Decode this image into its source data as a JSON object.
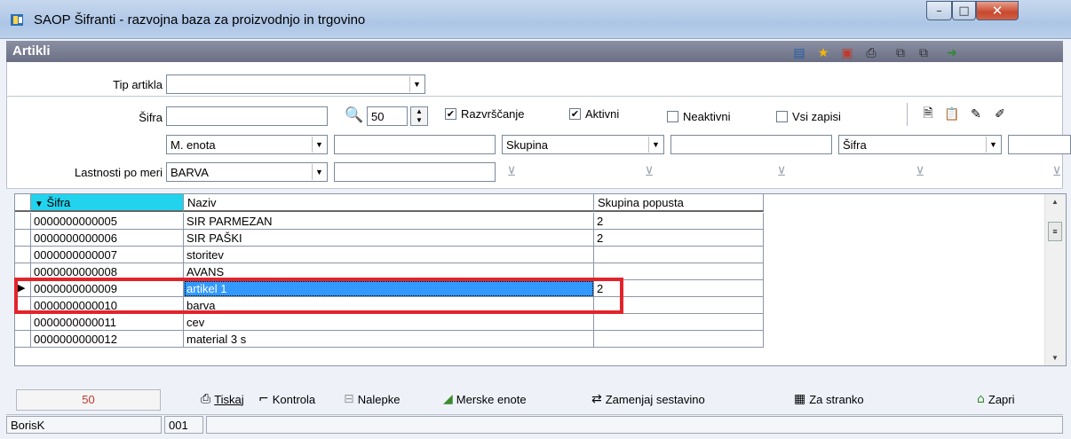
{
  "window": {
    "title": "SAOP Šifranti - razvojna baza za proizvodnjo in trgovino",
    "controls": {
      "minimize": "–",
      "maximize": "□",
      "close": "✕"
    }
  },
  "header": {
    "title": "Artikli",
    "toolbar_icons": [
      "columns-icon",
      "star-icon",
      "excel-export-icon",
      "print-icon",
      "copy-icon",
      "paste-icon",
      "exit-icon"
    ]
  },
  "filters": {
    "tip_artikla_label": "Tip artikla",
    "tip_artikla_value": "",
    "sifra_label": "Šifra",
    "sifra_value": "",
    "count_value": "50",
    "razvrscanje_label": "Razvrščanje",
    "razvrscanje_checked": true,
    "aktivni_label": "Aktivni",
    "aktivni_checked": true,
    "neaktivni_label": "Neaktivni",
    "neaktivni_checked": false,
    "vsi_label": "Vsi zapisi",
    "vsi_checked": false,
    "combo1_value": "M. enota",
    "combo2_value": "Skupina",
    "combo3_value": "Šifra",
    "lastnosti_label": "Lastnosti po meri",
    "lastnosti_value": "BARVA"
  },
  "grid": {
    "columns": [
      "Šifra",
      "Naziv",
      "Skupina popusta"
    ],
    "rows": [
      {
        "sifra": "0000000000005",
        "naziv": "SIR PARMEZAN",
        "skupina": "2"
      },
      {
        "sifra": "0000000000006",
        "naziv": "SIR PAŠKI",
        "skupina": "2"
      },
      {
        "sifra": "0000000000007",
        "naziv": "storitev",
        "skupina": ""
      },
      {
        "sifra": "0000000000008",
        "naziv": "AVANS",
        "skupina": ""
      },
      {
        "sifra": "0000000000009",
        "naziv": "artikel 1",
        "skupina": "2"
      },
      {
        "sifra": "0000000000010",
        "naziv": "barva",
        "skupina": ""
      },
      {
        "sifra": "0000000000011",
        "naziv": "cev",
        "skupina": ""
      },
      {
        "sifra": "0000000000012",
        "naziv": "material 3 s",
        "skupina": ""
      }
    ],
    "selected_row": 4,
    "highlight_color": "#e3232a",
    "header_accent": "#22d3ee"
  },
  "bottom": {
    "count": "50",
    "tiskaj": "Tiskaj",
    "kontrola": "Kontrola",
    "nalepke": "Nalepke",
    "merske": "Merske enote",
    "zamenjaj": "Zamenjaj sestavino",
    "za_stranko": "Za stranko",
    "zapri": "Zapri"
  },
  "status": {
    "user": "BorisK",
    "code": "001"
  }
}
